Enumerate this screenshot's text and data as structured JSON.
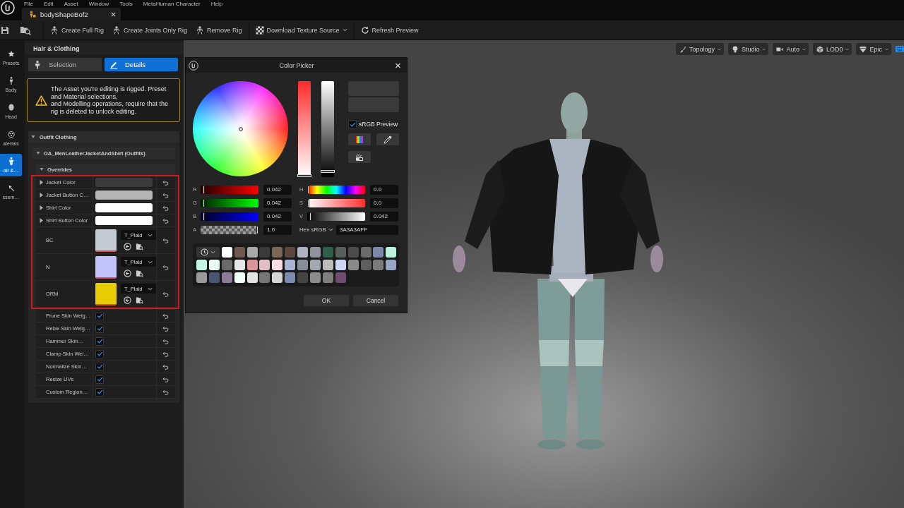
{
  "menu_bar": [
    {
      "label": "File"
    },
    {
      "label": "Edit"
    },
    {
      "label": "Asset"
    },
    {
      "label": "Window"
    },
    {
      "label": "Tools"
    },
    {
      "label": "MetaHuman Character"
    },
    {
      "label": "Help"
    }
  ],
  "document_tab": {
    "title": "bodyShapeBof2"
  },
  "toolbar_groups": [
    {
      "buttons": [
        {
          "label": "Create Full Rig",
          "dropdown": false
        },
        {
          "label": "Create Joints Only Rig",
          "dropdown": false
        },
        {
          "label": "Remove Rig",
          "dropdown": false
        }
      ]
    },
    {
      "buttons": [
        {
          "label": "Download Texture Source",
          "dropdown": true
        }
      ]
    },
    {
      "buttons": [
        {
          "label": "Refresh Preview",
          "dropdown": false
        }
      ]
    }
  ],
  "mode_sidebar": [
    {
      "label": "Presets",
      "selected": false
    },
    {
      "label": "Body",
      "selected": false
    },
    {
      "label": "Head",
      "selected": false
    },
    {
      "label": "aterials",
      "selected": false
    },
    {
      "label": "air &…",
      "selected": true
    },
    {
      "label": "ssem…",
      "selected": false
    }
  ],
  "panel": {
    "title": "Hair & Clothing",
    "tabs": [
      {
        "label": "Selection",
        "selected": false
      },
      {
        "label": "Details",
        "selected": true
      }
    ],
    "warning": "The Asset you're editing is rigged. Preset and Material selections,\nand Modelling operations, require that the rig is deleted to unlock editing.",
    "section": {
      "label": "Outfit Clothing",
      "expanded": true
    },
    "asset": {
      "label": "OA_MenLeatherJacketAndShirt (Outfits)",
      "expanded": true
    },
    "overrides": {
      "label": "Overrides",
      "expanded": true,
      "highlighted_rows": [
        {
          "kind": "color",
          "label": "Jacket Color",
          "expanded": false,
          "color": "#3a3a3a"
        },
        {
          "kind": "color",
          "label": "Jacket Button C…",
          "expanded": false,
          "color": "#b4b4b4"
        },
        {
          "kind": "color",
          "label": "Shirt Color",
          "expanded": false,
          "color": "#ffffff"
        },
        {
          "kind": "color",
          "label": "Shirt Button Color",
          "expanded": false,
          "color": "#ffffff"
        },
        {
          "kind": "texture",
          "label": "BC",
          "asset": "T_Plaid",
          "color": "#c6cad2"
        },
        {
          "kind": "texture",
          "label": "N",
          "asset": "T_Plaid",
          "color": "#c4c4fc"
        },
        {
          "kind": "texture",
          "label": "ORM",
          "asset": "T_Plaid",
          "color": "#e6cc00"
        }
      ],
      "rows": [
        {
          "kind": "checkbox",
          "label": "Prune Skin Weig…",
          "checked": true
        },
        {
          "kind": "checkbox",
          "label": "Relax Skin Weig…",
          "checked": true
        },
        {
          "kind": "checkbox",
          "label": "Hammer Skin…",
          "checked": true
        },
        {
          "kind": "checkbox",
          "label": "Clamp Skin Wei…",
          "checked": true
        },
        {
          "kind": "checkbox",
          "label": "Normalize Skin…",
          "checked": true
        },
        {
          "kind": "checkbox",
          "label": "Resize UVs",
          "checked": true
        },
        {
          "kind": "checkbox",
          "label": "Custom Region…",
          "checked": true
        }
      ]
    }
  },
  "viewport": {
    "toolbar": [
      {
        "label": "Topology",
        "dropdown": true
      },
      {
        "label": "Studio",
        "dropdown": true
      },
      {
        "label": "Auto",
        "dropdown": true
      },
      {
        "label": "LOD0",
        "dropdown": true
      },
      {
        "label": "Epic",
        "dropdown": true
      }
    ]
  },
  "color_picker": {
    "title": "Color Picker",
    "preview": [
      {
        "color": "#3a3a3a"
      },
      {
        "color": "#3a3a3a"
      }
    ],
    "srgb_preview": {
      "label": "sRGB Preview",
      "checked": true
    },
    "rgb": [
      {
        "label": "R",
        "level": 0.042,
        "value": "0.042"
      },
      {
        "label": "G",
        "level": 0.042,
        "value": "0.042"
      },
      {
        "label": "B",
        "level": 0.042,
        "value": "0.042"
      },
      {
        "label": "A",
        "level": 1.0,
        "value": "1.0"
      }
    ],
    "hsv": [
      {
        "label": "H",
        "level": 0.0,
        "value": "0.0"
      },
      {
        "label": "S",
        "level": 0.0,
        "value": "0.0"
      },
      {
        "label": "V",
        "level": 0.042,
        "value": "0.042"
      }
    ],
    "hex": {
      "mode": "Hex sRGB",
      "value": "3A3A3AFF"
    },
    "swatches": [
      {
        "color": "#ffffff"
      },
      {
        "color": "#6e5a50"
      },
      {
        "color": "#a9a9a9"
      },
      {
        "color": "#3a3a3a"
      },
      {
        "color": "#7c6656"
      },
      {
        "color": "#5c463e"
      },
      {
        "color": "#aeb3bf"
      },
      {
        "color": "#8f939d"
      },
      {
        "color": "#2f5f48"
      },
      {
        "color": "#56605b"
      },
      {
        "color": "#4b4b4b"
      },
      {
        "color": "#6b6b6b"
      },
      {
        "color": "#7c88a8"
      },
      {
        "color": "#baf2da"
      },
      {
        "color": "#c4f5e2"
      },
      {
        "color": "#e8faf2"
      },
      {
        "color": "#6a6a6a"
      },
      {
        "color": "#e6e6e6"
      },
      {
        "color": "#d9959a"
      },
      {
        "color": "#e0c0c4"
      },
      {
        "color": "#fadce2"
      },
      {
        "color": "#a8b4d4"
      },
      {
        "color": "#868e9c"
      },
      {
        "color": "#a4a8b2"
      },
      {
        "color": "#bcbcbc"
      },
      {
        "color": "#cdd6f6"
      },
      {
        "color": "#8a8a8a"
      },
      {
        "color": "#5e5e5e"
      },
      {
        "color": "#7a7a7a"
      },
      {
        "color": "#98a4c4"
      },
      {
        "color": "#9a9a9a"
      },
      {
        "color": "#4a5670"
      },
      {
        "color": "#8a7c94"
      },
      {
        "color": "#f0fff8"
      },
      {
        "color": "#e4e4e4"
      },
      {
        "color": "#767676"
      },
      {
        "color": "#d6d6d6"
      },
      {
        "color": "#7c8cb0"
      },
      {
        "color": "#444444"
      },
      {
        "color": "#8c8c8c"
      },
      {
        "color": "#7e7e7e"
      },
      {
        "color": "#6e4c6e"
      }
    ],
    "buttons": [
      {
        "label": "OK"
      },
      {
        "label": "Cancel"
      }
    ]
  }
}
